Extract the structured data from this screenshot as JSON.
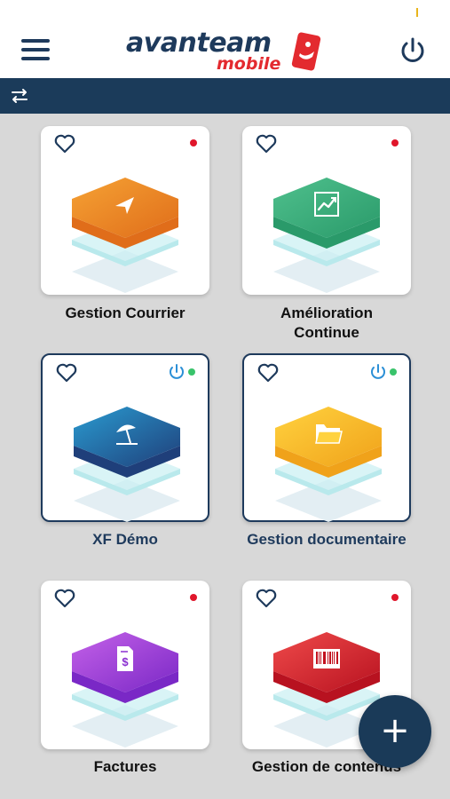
{
  "header": {
    "logo_main": "avanteam",
    "logo_sub": "mobile",
    "menu_icon": "hamburger-menu-icon",
    "power_icon": "power-icon"
  },
  "toolbar": {
    "switch_icon": "swap-arrows-icon"
  },
  "colors": {
    "navy": "#1e3a5c",
    "red": "#e32a2f",
    "green": "#39c36b",
    "background": "#d8d8d8"
  },
  "apps": [
    {
      "label_lines": [
        "Gestion Courrier"
      ],
      "icon": "paper-plane-icon",
      "status": "offline",
      "active": false,
      "top": "#f5a234",
      "bottom": "#e06d1a"
    },
    {
      "label_lines": [
        "Amélioration",
        "Continue"
      ],
      "icon": "chart-icon",
      "status": "offline",
      "active": false,
      "top": "#4fc08d",
      "bottom": "#2a9a6a"
    },
    {
      "label_lines": [
        "XF Démo"
      ],
      "icon": "beach-umbrella-icon",
      "status": "online",
      "active": true,
      "top": "#2a9bd0",
      "bottom": "#1f3f7a"
    },
    {
      "label_lines": [
        "Gestion documentaire"
      ],
      "icon": "folder-icon",
      "status": "online",
      "active": true,
      "top": "#ffd23f",
      "bottom": "#f0a21a"
    },
    {
      "label_lines": [
        "Factures"
      ],
      "icon": "invoice-icon",
      "status": "offline",
      "active": false,
      "top": "#c461e8",
      "bottom": "#7a28c6"
    },
    {
      "label_lines": [
        "Gestion de contenus"
      ],
      "icon": "barcode-icon",
      "status": "offline",
      "active": false,
      "top": "#ef4a4a",
      "bottom": "#b81220"
    }
  ],
  "fab": {
    "label": "+"
  }
}
